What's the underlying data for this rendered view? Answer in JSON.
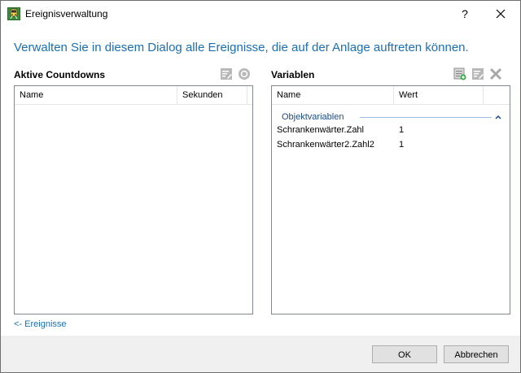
{
  "window": {
    "title": "Ereignisverwaltung",
    "help_label": "?",
    "close_icon": "close-icon",
    "app_icon": "train-icon"
  },
  "intro_text": "Verwalten Sie in diesem Dialog alle Ereignisse, die auf der Anlage auftreten können.",
  "countdowns": {
    "title": "Aktive Countdowns",
    "columns": [
      "Name",
      "Sekunden"
    ],
    "rows": [],
    "toolbar_icons": [
      "edit-icon",
      "stop-icon"
    ]
  },
  "variables": {
    "title": "Variablen",
    "columns": [
      "Name",
      "Wert"
    ],
    "toolbar_icons": [
      "add-icon",
      "edit-icon",
      "delete-icon"
    ],
    "group": {
      "label": "Objektvariablen",
      "expanded": true
    },
    "rows": [
      {
        "name": "Schrankenwärter.Zahl",
        "value": "1"
      },
      {
        "name": "Schrankenwärter2.Zahl2",
        "value": "1"
      }
    ]
  },
  "back_link": "<- Ereignisse",
  "buttons": {
    "ok": "OK",
    "cancel": "Abbrechen"
  },
  "colors": {
    "accent": "#1a6fb5",
    "footer": "#f0f0f0"
  }
}
